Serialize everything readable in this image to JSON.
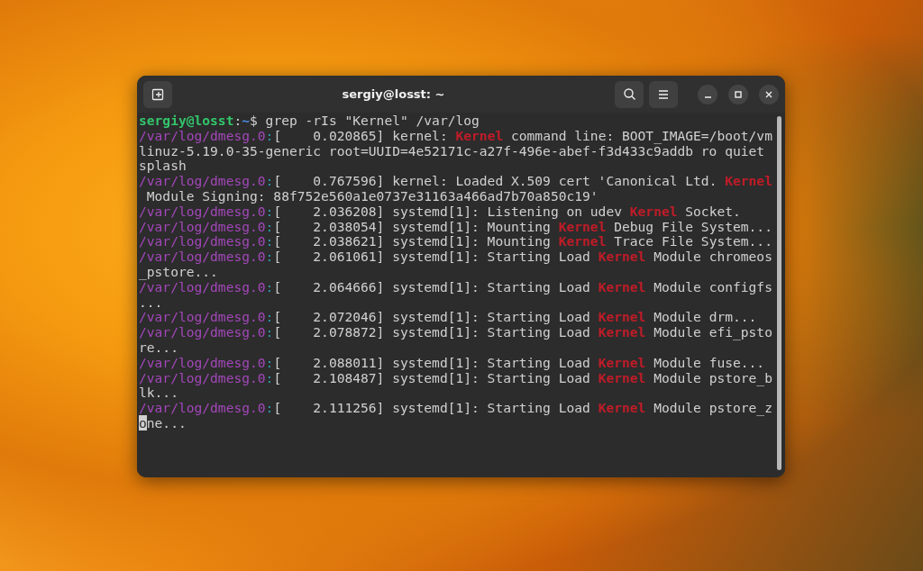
{
  "window": {
    "title": "sergiy@losst: ~"
  },
  "terminal": {
    "lines": [
      [
        {
          "kind": "user",
          "text": "sergiy@losst"
        },
        {
          "kind": "plain",
          "text": ":"
        },
        {
          "kind": "dir",
          "text": "~"
        },
        {
          "kind": "plain",
          "text": "$ grep -rIs \"Kernel\" /var/log"
        }
      ],
      [
        {
          "kind": "file",
          "text": "/var/log/dmesg.0"
        },
        {
          "kind": "colon",
          "text": ":"
        },
        {
          "kind": "plain",
          "text": "[    0.020865] kernel: "
        },
        {
          "kind": "match",
          "text": "Kernel"
        },
        {
          "kind": "plain",
          "text": " command line: BOOT_IMAGE=/boot/vm"
        }
      ],
      [
        {
          "kind": "plain",
          "text": "linuz-5.19.0-35-generic root=UUID=4e52171c-a27f-496e-abef-f3d433c9addb ro quiet"
        }
      ],
      [
        {
          "kind": "plain",
          "text": "splash"
        }
      ],
      [
        {
          "kind": "file",
          "text": "/var/log/dmesg.0"
        },
        {
          "kind": "colon",
          "text": ":"
        },
        {
          "kind": "plain",
          "text": "[    0.767596] kernel: Loaded X.509 cert 'Canonical Ltd. "
        },
        {
          "kind": "match",
          "text": "Kernel"
        }
      ],
      [
        {
          "kind": "plain",
          "text": " Module Signing: 88f752e560a1e0737e31163a466ad7b70a850c19'"
        }
      ],
      [
        {
          "kind": "file",
          "text": "/var/log/dmesg.0"
        },
        {
          "kind": "colon",
          "text": ":"
        },
        {
          "kind": "plain",
          "text": "[    2.036208] systemd[1]: Listening on udev "
        },
        {
          "kind": "match",
          "text": "Kernel"
        },
        {
          "kind": "plain",
          "text": " Socket."
        }
      ],
      [
        {
          "kind": "file",
          "text": "/var/log/dmesg.0"
        },
        {
          "kind": "colon",
          "text": ":"
        },
        {
          "kind": "plain",
          "text": "[    2.038054] systemd[1]: Mounting "
        },
        {
          "kind": "match",
          "text": "Kernel"
        },
        {
          "kind": "plain",
          "text": " Debug File System..."
        }
      ],
      [
        {
          "kind": "file",
          "text": "/var/log/dmesg.0"
        },
        {
          "kind": "colon",
          "text": ":"
        },
        {
          "kind": "plain",
          "text": "[    2.038621] systemd[1]: Mounting "
        },
        {
          "kind": "match",
          "text": "Kernel"
        },
        {
          "kind": "plain",
          "text": " Trace File System..."
        }
      ],
      [
        {
          "kind": "file",
          "text": "/var/log/dmesg.0"
        },
        {
          "kind": "colon",
          "text": ":"
        },
        {
          "kind": "plain",
          "text": "[    2.061061] systemd[1]: Starting Load "
        },
        {
          "kind": "match",
          "text": "Kernel"
        },
        {
          "kind": "plain",
          "text": " Module chromeos"
        }
      ],
      [
        {
          "kind": "plain",
          "text": "_pstore..."
        }
      ],
      [
        {
          "kind": "file",
          "text": "/var/log/dmesg.0"
        },
        {
          "kind": "colon",
          "text": ":"
        },
        {
          "kind": "plain",
          "text": "[    2.064666] systemd[1]: Starting Load "
        },
        {
          "kind": "match",
          "text": "Kernel"
        },
        {
          "kind": "plain",
          "text": " Module configfs"
        }
      ],
      [
        {
          "kind": "plain",
          "text": "..."
        }
      ],
      [
        {
          "kind": "file",
          "text": "/var/log/dmesg.0"
        },
        {
          "kind": "colon",
          "text": ":"
        },
        {
          "kind": "plain",
          "text": "[    2.072046] systemd[1]: Starting Load "
        },
        {
          "kind": "match",
          "text": "Kernel"
        },
        {
          "kind": "plain",
          "text": " Module drm..."
        }
      ],
      [
        {
          "kind": "file",
          "text": "/var/log/dmesg.0"
        },
        {
          "kind": "colon",
          "text": ":"
        },
        {
          "kind": "plain",
          "text": "[    2.078872] systemd[1]: Starting Load "
        },
        {
          "kind": "match",
          "text": "Kernel"
        },
        {
          "kind": "plain",
          "text": " Module efi_psto"
        }
      ],
      [
        {
          "kind": "plain",
          "text": "re..."
        }
      ],
      [
        {
          "kind": "file",
          "text": "/var/log/dmesg.0"
        },
        {
          "kind": "colon",
          "text": ":"
        },
        {
          "kind": "plain",
          "text": "[    2.088011] systemd[1]: Starting Load "
        },
        {
          "kind": "match",
          "text": "Kernel"
        },
        {
          "kind": "plain",
          "text": " Module fuse..."
        }
      ],
      [
        {
          "kind": "file",
          "text": "/var/log/dmesg.0"
        },
        {
          "kind": "colon",
          "text": ":"
        },
        {
          "kind": "plain",
          "text": "[    2.108487] systemd[1]: Starting Load "
        },
        {
          "kind": "match",
          "text": "Kernel"
        },
        {
          "kind": "plain",
          "text": " Module pstore_b"
        }
      ],
      [
        {
          "kind": "plain",
          "text": "lk..."
        }
      ],
      [
        {
          "kind": "file",
          "text": "/var/log/dmesg.0"
        },
        {
          "kind": "colon",
          "text": ":"
        },
        {
          "kind": "plain",
          "text": "[    2.111256] systemd[1]: Starting Load "
        },
        {
          "kind": "match",
          "text": "Kernel"
        },
        {
          "kind": "plain",
          "text": " Module pstore_z"
        }
      ],
      [
        {
          "kind": "cursor",
          "text": "o"
        },
        {
          "kind": "plain",
          "text": "ne..."
        }
      ]
    ]
  }
}
